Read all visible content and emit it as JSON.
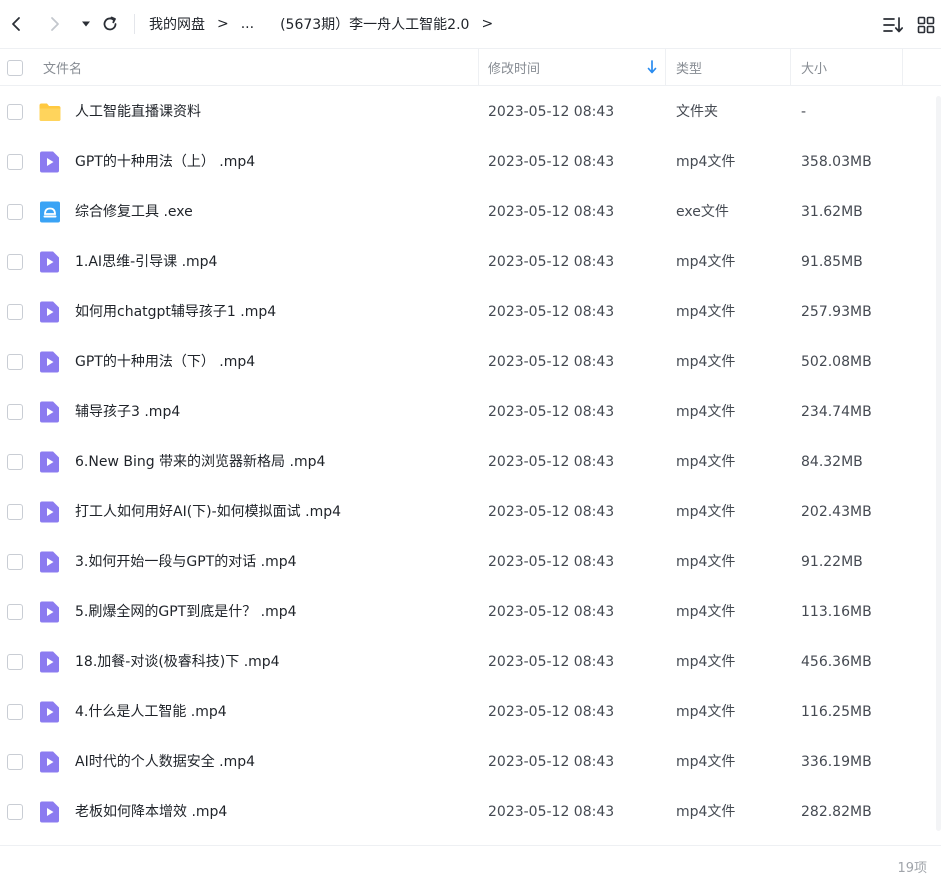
{
  "breadcrumb": {
    "root": "我的网盘",
    "sep1": ">",
    "ellipsis": "...",
    "current": "(5673期）李一舟人工智能2.0",
    "sep2": ">"
  },
  "columns": {
    "name": "文件名",
    "modified": "修改时间",
    "type": "类型",
    "size": "大小"
  },
  "icons": {
    "back": "chevron-left-icon",
    "forward": "chevron-right-icon",
    "history": "caret-down-icon",
    "refresh": "refresh-icon",
    "sort": "sort-list-icon",
    "view": "grid-view-icon",
    "folder": "folder-icon",
    "video": "video-file-icon",
    "exe": "exe-file-icon"
  },
  "colors": {
    "folder": "#FFC940",
    "video": "#8B7BF0",
    "exe": "#3AA3F5",
    "accent": "#2a8cf0"
  },
  "files": [
    {
      "name": "人工智能直播课资料",
      "time": "2023-05-12 08:43",
      "type": "文件夹",
      "size": "-",
      "icon": "folder"
    },
    {
      "name": "GPT的十种用法（上） .mp4",
      "time": "2023-05-12 08:43",
      "type": "mp4文件",
      "size": "358.03MB",
      "icon": "video"
    },
    {
      "name": "综合修复工具 .exe",
      "time": "2023-05-12 08:43",
      "type": "exe文件",
      "size": "31.62MB",
      "icon": "exe"
    },
    {
      "name": "1.AI思维-引导课 .mp4",
      "time": "2023-05-12 08:43",
      "type": "mp4文件",
      "size": "91.85MB",
      "icon": "video"
    },
    {
      "name": "如何用chatgpt辅导孩子1 .mp4",
      "time": "2023-05-12 08:43",
      "type": "mp4文件",
      "size": "257.93MB",
      "icon": "video"
    },
    {
      "name": "GPT的十种用法（下） .mp4",
      "time": "2023-05-12 08:43",
      "type": "mp4文件",
      "size": "502.08MB",
      "icon": "video"
    },
    {
      "name": "辅导孩子3 .mp4",
      "time": "2023-05-12 08:43",
      "type": "mp4文件",
      "size": "234.74MB",
      "icon": "video"
    },
    {
      "name": "6.New Bing 带来的浏览器新格局 .mp4",
      "time": "2023-05-12 08:43",
      "type": "mp4文件",
      "size": "84.32MB",
      "icon": "video"
    },
    {
      "name": "打工人如何用好AI(下)-如何模拟面试 .mp4",
      "time": "2023-05-12 08:43",
      "type": "mp4文件",
      "size": "202.43MB",
      "icon": "video"
    },
    {
      "name": "3.如何开始一段与GPT的对话 .mp4",
      "time": "2023-05-12 08:43",
      "type": "mp4文件",
      "size": "91.22MB",
      "icon": "video"
    },
    {
      "name": "5.刷爆全网的GPT到底是什？ .mp4",
      "time": "2023-05-12 08:43",
      "type": "mp4文件",
      "size": "113.16MB",
      "icon": "video"
    },
    {
      "name": "18.加餐-对谈(极睿科技)下 .mp4",
      "time": "2023-05-12 08:43",
      "type": "mp4文件",
      "size": "456.36MB",
      "icon": "video"
    },
    {
      "name": "4.什么是人工智能 .mp4",
      "time": "2023-05-12 08:43",
      "type": "mp4文件",
      "size": "116.25MB",
      "icon": "video"
    },
    {
      "name": "AI时代的个人数据安全 .mp4",
      "time": "2023-05-12 08:43",
      "type": "mp4文件",
      "size": "336.19MB",
      "icon": "video"
    },
    {
      "name": "老板如何降本增效 .mp4",
      "time": "2023-05-12 08:43",
      "type": "mp4文件",
      "size": "282.82MB",
      "icon": "video"
    }
  ],
  "footer": {
    "count": "19项"
  }
}
